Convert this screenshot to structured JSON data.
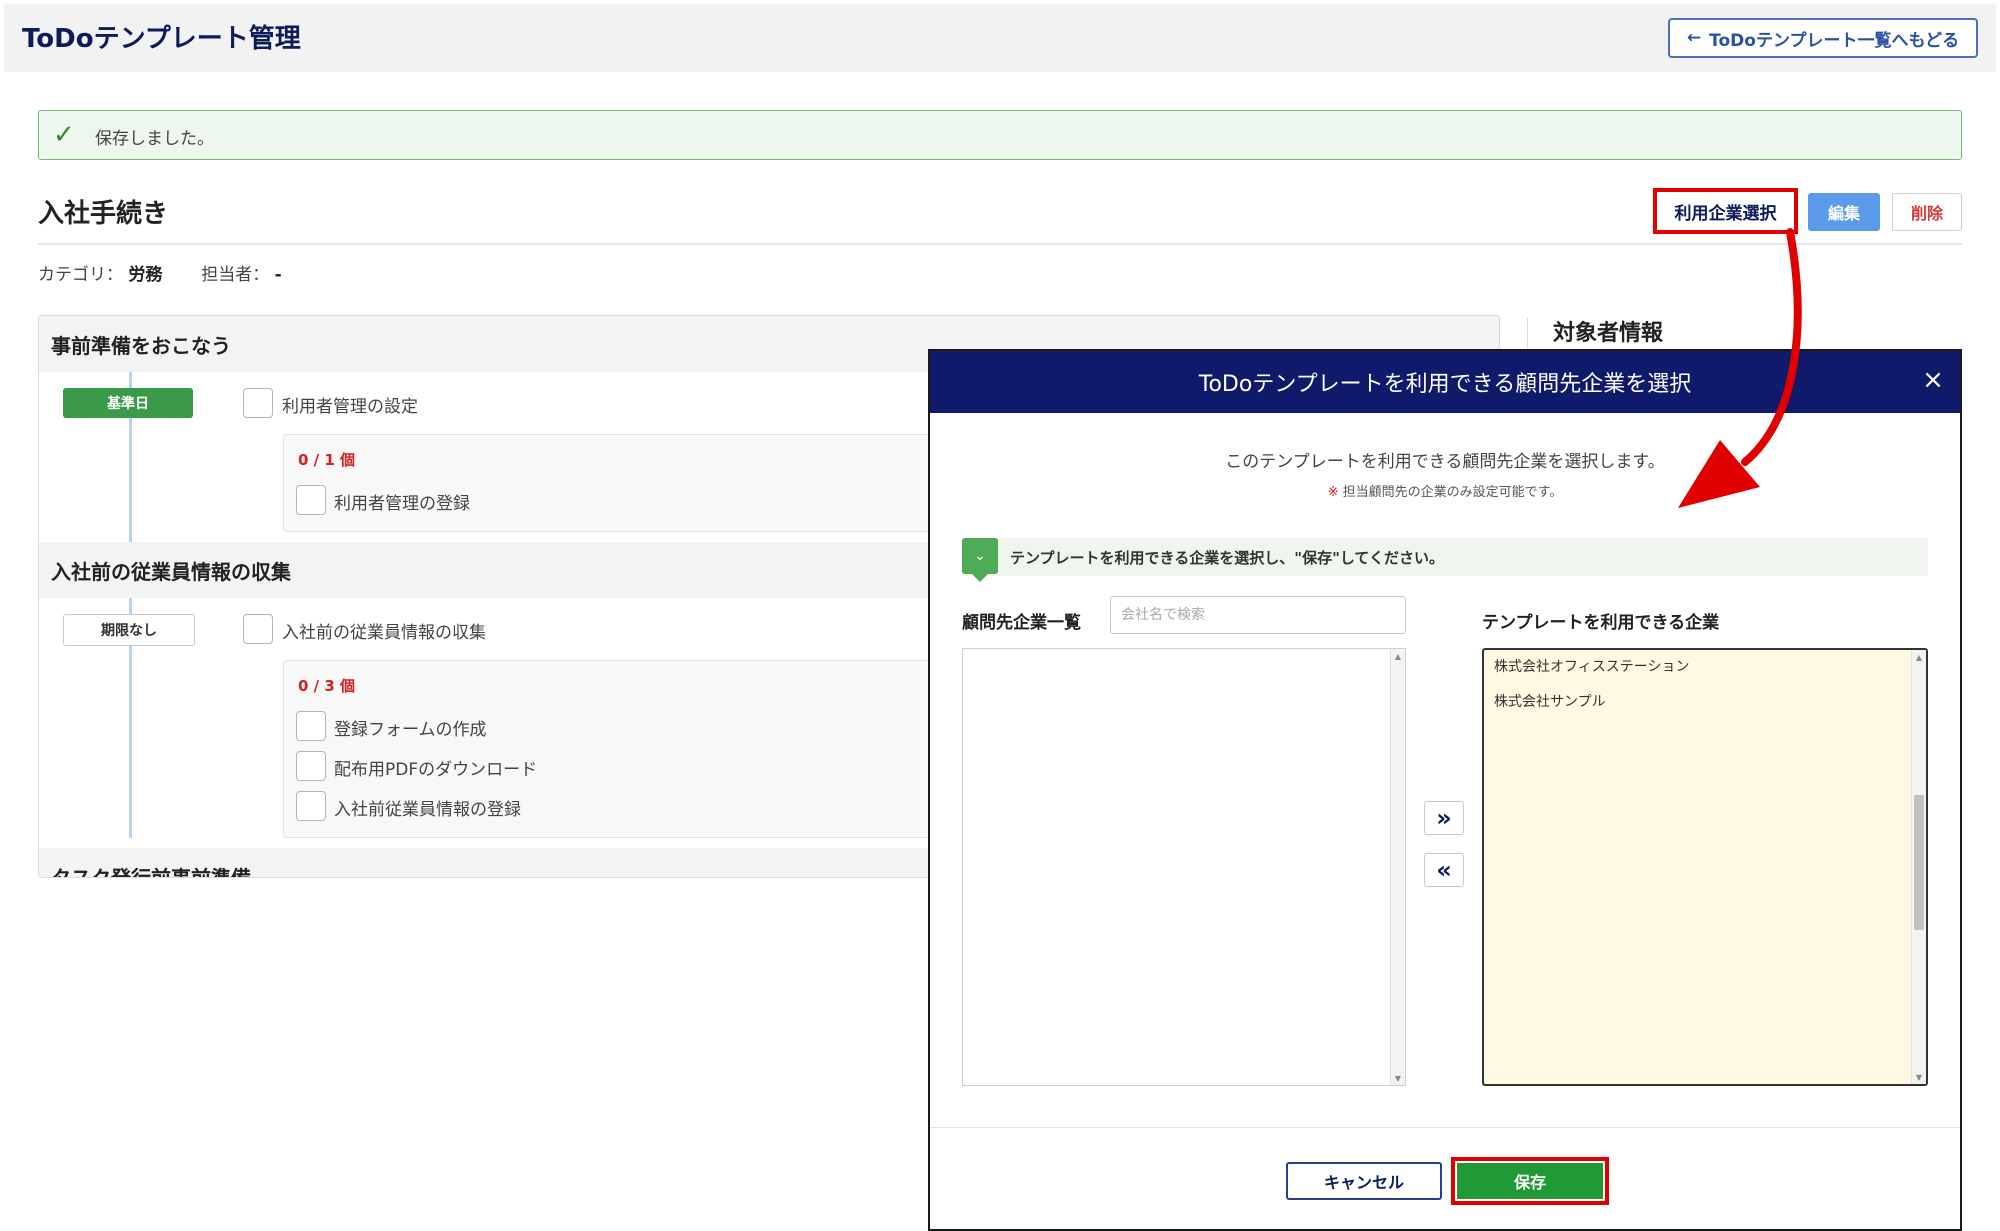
{
  "header": {
    "title": "ToDoテンプレート管理",
    "back_label": "ToDoテンプレート一覧へもどる"
  },
  "alert": {
    "text": "保存しました。"
  },
  "page": {
    "title": "入社手続き",
    "actions": {
      "company_select": "利用企業選択",
      "edit": "編集",
      "delete": "削除"
    },
    "meta": {
      "category_label": "カテゴリ：",
      "category_value": "労務",
      "assignee_label": "担当者：",
      "assignee_value": "-"
    }
  },
  "sections": [
    {
      "title": "事前準備をおこなう",
      "badge": "基準日",
      "task": "利用者管理の設定",
      "counter": "0 / 1 個",
      "subtasks": [
        "利用者管理の登録"
      ]
    },
    {
      "title": "入社前の従業員情報の収集",
      "badge": "期限なし",
      "task": "入社前の従業員情報の収集",
      "counter": "0 / 3 個",
      "subtasks": [
        "登録フォームの作成",
        "配布用PDFのダウンロード",
        "入社前従業員情報の登録"
      ]
    },
    {
      "title": "タスク発行前事前準備"
    }
  ],
  "side": {
    "target_title": "対象者情報"
  },
  "modal": {
    "title": "ToDoテンプレートを利用できる顧問先企業を選択",
    "close_glyph": "×",
    "description": "このテンプレートを利用できる顧問先企業を選択します。",
    "note_mark": "※",
    "note": "担当顧問先の企業のみ設定可能です。",
    "hint": "テンプレートを利用できる企業を選択し、\"保存\"してください。",
    "left_label": "顧問先企業一覧",
    "search_placeholder": "会社名で検索",
    "right_label": "テンプレートを利用できる企業",
    "selected_companies": [
      "株式会社オフィスステーション",
      "株式会社サンプル"
    ],
    "move_right_glyph": "»",
    "move_left_glyph": "«",
    "cancel_label": "キャンセル",
    "save_label": "保存"
  },
  "colors": {
    "navy": "#101a6b",
    "highlight_red": "#e00000",
    "save_green": "#1f9a36",
    "badge_green": "#3a9a4a",
    "counter_red": "#d42020"
  }
}
